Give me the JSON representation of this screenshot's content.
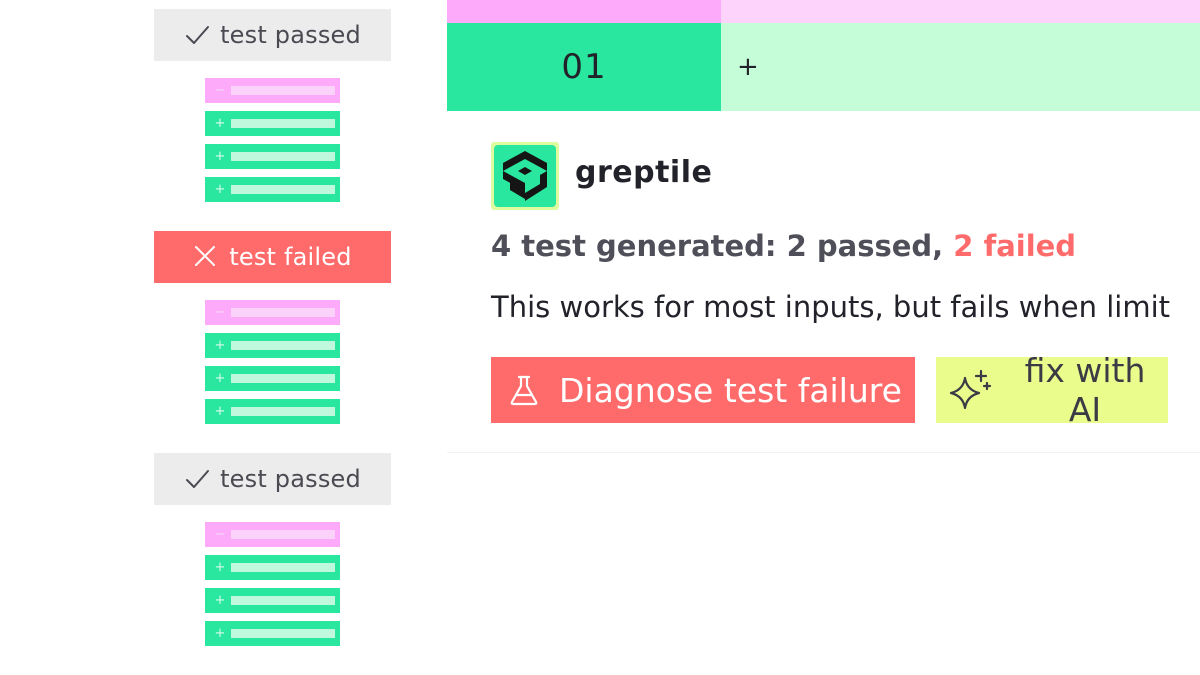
{
  "tests": [
    {
      "status": "passed",
      "label": "test passed",
      "icon": "check-icon",
      "diff_lines": [
        {
          "type": "minus",
          "sign": "−"
        },
        {
          "type": "plus",
          "sign": "+"
        },
        {
          "type": "plus",
          "sign": "+"
        },
        {
          "type": "plus",
          "sign": "+"
        }
      ]
    },
    {
      "status": "failed",
      "label": "test failed",
      "icon": "close-icon",
      "diff_lines": [
        {
          "type": "minus",
          "sign": "−"
        },
        {
          "type": "plus",
          "sign": "+"
        },
        {
          "type": "plus",
          "sign": "+"
        },
        {
          "type": "plus",
          "sign": "+"
        }
      ]
    },
    {
      "status": "passed",
      "label": "test passed",
      "icon": "check-icon",
      "diff_lines": [
        {
          "type": "minus",
          "sign": "−"
        },
        {
          "type": "plus",
          "sign": "+"
        },
        {
          "type": "plus",
          "sign": "+"
        },
        {
          "type": "plus",
          "sign": "+"
        }
      ]
    }
  ],
  "diff": {
    "line_number": "01",
    "line_marker": "+"
  },
  "comment": {
    "author": "greptile",
    "summary_prefix": "4 test generated: 2 passed, ",
    "summary_failed": "2 failed",
    "description": "This works for most inputs, but fails when limit",
    "diagnose_label": "Diagnose test failure",
    "fix_label": "fix with AI"
  },
  "colors": {
    "pass_bg": "#ececec",
    "fail_red": "#ff6b6b",
    "add_green": "#2ae79f",
    "add_green_light": "#c4fdd8",
    "remove_pink": "#fdaafb",
    "remove_pink_light": "#fdd2fb",
    "ai_yellow": "#eafc8c"
  }
}
